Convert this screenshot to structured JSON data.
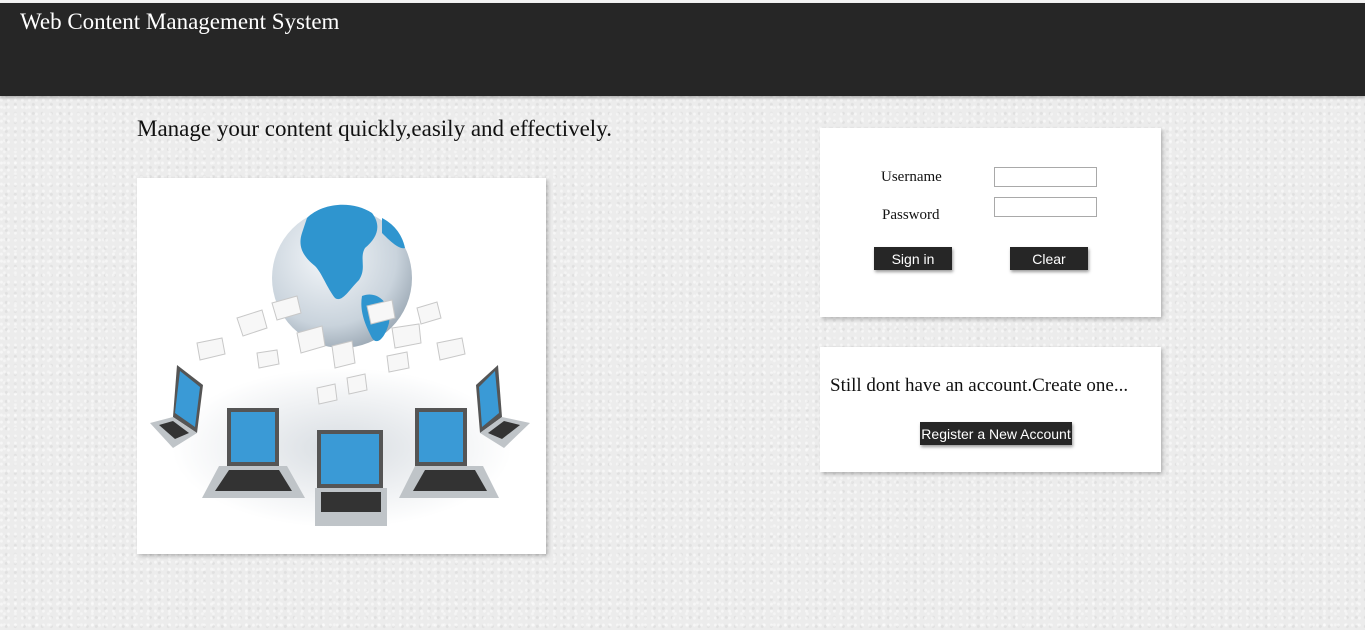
{
  "header": {
    "title": "Web Content Management System"
  },
  "main": {
    "tagline": "Manage your content quickly,easily and effectively.",
    "hero_image": "globe-and-laptops-network-illustration"
  },
  "login": {
    "username_label": "Username",
    "username_value": "",
    "password_label": "Password",
    "password_value": "",
    "signin_label": "Sign in",
    "clear_label": "Clear"
  },
  "register": {
    "prompt": "Still dont have an account.Create one...",
    "button_label": "Register a New Account"
  },
  "colors": {
    "header_bg": "#262626",
    "button_bg": "#262626",
    "page_bg": "#ececec",
    "globe_blue": "#2f95cf"
  }
}
